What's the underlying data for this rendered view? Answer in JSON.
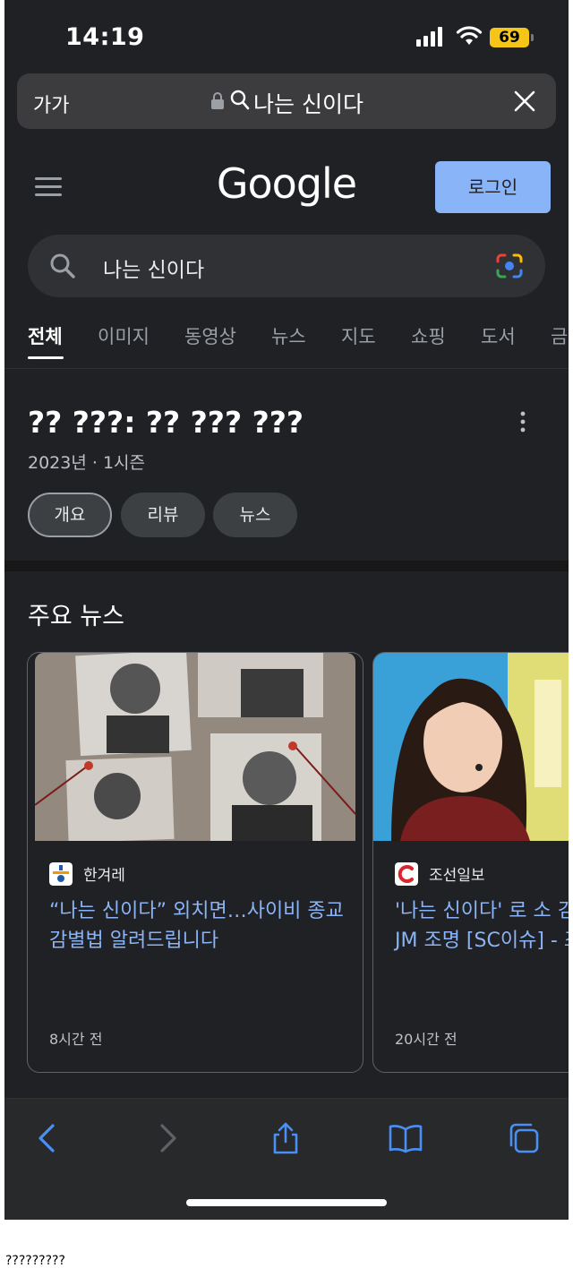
{
  "status": {
    "time": "14:19",
    "battery": "69"
  },
  "address": {
    "text_size": "가가",
    "query": "나는 신이다"
  },
  "google": {
    "logo": "Google",
    "login": "로그인",
    "search_value": "나는 신이다",
    "tabs": [
      "전체",
      "이미지",
      "동영상",
      "뉴스",
      "지도",
      "쇼핑",
      "도서",
      "금"
    ],
    "entity": {
      "title": "?? ???: ?? ??? ???",
      "subtitle": "2023년 · 1시즌",
      "chips": [
        "개요",
        "리뷰",
        "뉴스"
      ]
    },
    "top_news": {
      "heading": "주요 뉴스",
      "cards": [
        {
          "source": "한겨레",
          "headline": "“나는 신이다” 외치면…사이비 종교 감별법 알려드립니다",
          "time": "8시간 전"
        },
        {
          "source": "조선일보",
          "headline": "'나는 신이다' 로 소 김성경, 아찔한 JM 조명 [SC이슈] - 조",
          "time": "20시간 전"
        }
      ]
    }
  },
  "colors": {
    "background": "#202124",
    "link": "#8ab4f8",
    "login_bg": "#8ab4f8",
    "battery": "#f5c518"
  },
  "icons": [
    "lock-icon",
    "search-icon",
    "close-icon",
    "menu-icon",
    "lens-icon",
    "kebab-icon",
    "back-icon",
    "forward-icon",
    "share-icon",
    "bookmarks-icon",
    "tabs-icon"
  ],
  "caption": "?????????"
}
